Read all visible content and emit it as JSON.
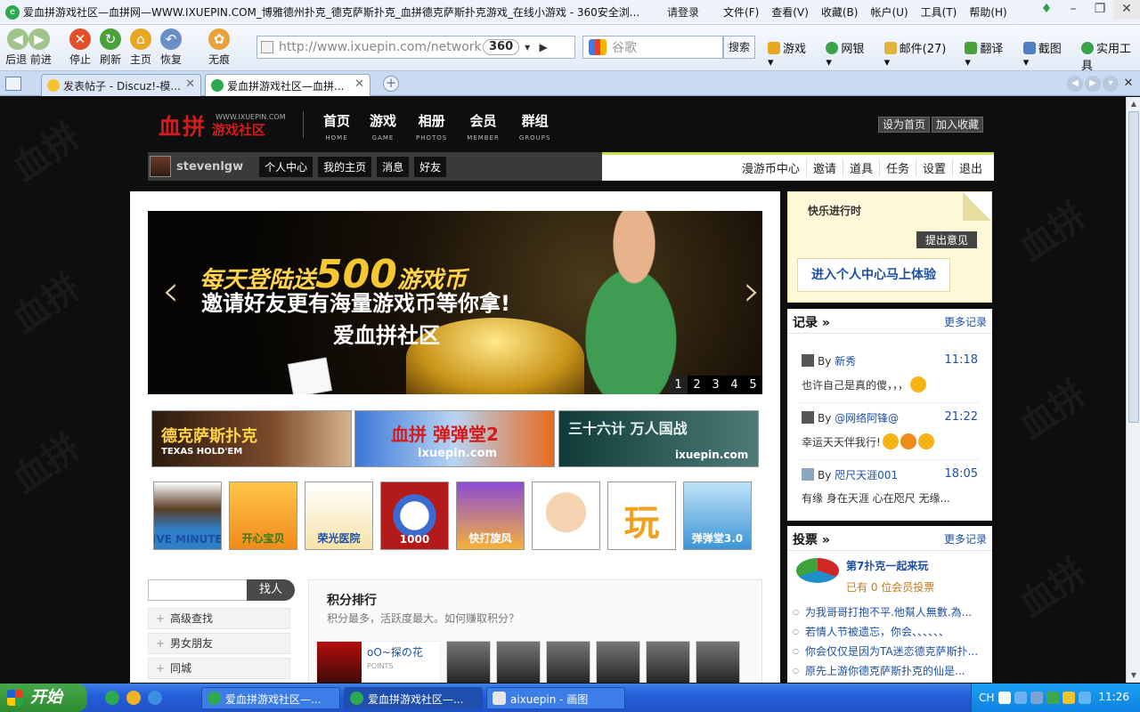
{
  "window": {
    "title": "爱血拼游戏社区—血拼网—WWW.IXUEPIN.COM_博雅德州扑克_德克萨斯扑克_血拼德克萨斯扑克游戏_在线小游戏 - 360安全浏...",
    "login": "请登录",
    "menus": [
      "文件(F)",
      "查看(V)",
      "收藏(B)",
      "帐户(U)",
      "工具(T)",
      "帮助(H)"
    ]
  },
  "toolbar": {
    "back_fwd": "后退 前进",
    "stop": "停止",
    "refresh": "刷新",
    "home": "主页",
    "restore": "恢复",
    "incognito": "无痕",
    "url": "http://www.ixuepin.com/network.ph",
    "badge": "360",
    "search_placeholder": "谷歌",
    "search_button": "搜索",
    "tools": [
      "游戏",
      "网银",
      "邮件(27)",
      "翻译",
      "截图",
      "实用工具"
    ]
  },
  "tabs": [
    {
      "label": "发表帖子 - Discuz!-模..."
    },
    {
      "label": "爱血拼游戏社区—血拼..."
    }
  ],
  "site": {
    "logo_main": "血拼",
    "logo_sub": "游戏社区",
    "logo_url": "WWW.IXUEPIN.COM",
    "nav": [
      {
        "cn": "首页",
        "en": "HOME"
      },
      {
        "cn": "游戏",
        "en": "GAME"
      },
      {
        "cn": "相册",
        "en": "PHOTOS"
      },
      {
        "cn": "会员",
        "en": "MEMBER"
      },
      {
        "cn": "群组",
        "en": "GROUPS"
      }
    ],
    "set_home": "设为首页",
    "add_fav": "加入收藏",
    "username": "stevenlgw",
    "user_links": [
      "个人中心",
      "我的主页",
      "消息",
      "好友"
    ],
    "right_links": [
      "漫游币中心",
      "邀请",
      "道具",
      "任务",
      "设置",
      "退出"
    ]
  },
  "banner": {
    "line1_a": "每天登陆送",
    "line1_b": "500",
    "line1_c": "游戏币",
    "line2": "邀请好友更有海量游戏币等你拿!",
    "line3": "爱血拼社区",
    "pages": [
      "1",
      "2",
      "3",
      "4",
      "5"
    ],
    "active_page": 1
  },
  "ads": [
    {
      "title": "德克萨斯扑克",
      "sub": "TEXAS HOLD'EM"
    },
    {
      "title": "血拼 弹弹堂2",
      "sub": "ixuepin.com"
    },
    {
      "title": "三十六计 万人国战",
      "sub": "ixuepin.com"
    }
  ],
  "games": [
    "FIVE MINUTES",
    "开心宝贝",
    "荣光医院",
    "1000",
    "快打旋风",
    "",
    "玩",
    "弹弹堂3.0"
  ],
  "find": {
    "button": "找人"
  },
  "side_links": [
    "高级查找",
    "男女朋友",
    "同城"
  ],
  "ranking": {
    "title": "积分排行",
    "desc": "积分最多，活跃度最大。如何赚取积分？",
    "first_name": "oO~探の花",
    "points_label": "POINTS"
  },
  "happy": {
    "title": "快乐进行时",
    "suggest": "提出意见",
    "cta": "进入个人中心马上体验"
  },
  "records": {
    "title": "记录 »",
    "more": "更多记录",
    "items": [
      {
        "by": "By",
        "who": "新秀",
        "time": "11:18",
        "msg": "也许自己是真的傻，，，"
      },
      {
        "by": "By",
        "who": "@网络阿锋@",
        "time": "21:22",
        "msg": "幸运天天伴我行!"
      },
      {
        "by": "By",
        "who": "咫尺天涯001",
        "time": "18:05",
        "msg": "有缘 身在天涯 心在咫尺 无缘..."
      }
    ]
  },
  "votes": {
    "title": "投票 »",
    "more": "更多记录",
    "featured_title": "第7扑克一起来玩",
    "featured_count": "已有 0 位会员投票",
    "items": [
      "为我哥哥打抱不平.他幫人無數.為...",
      "若情人节被遗忘，你会、、、、、、",
      "你会仅仅是因为TA迷恋德克萨斯扑...",
      "原先上游你德克萨斯扑克的仙是..."
    ]
  },
  "taskbar": {
    "start": "开始",
    "tasks": [
      "爱血拼游戏社区—...",
      "爱血拼游戏社区—...",
      "aixuepin - 画图"
    ],
    "lang": "CH",
    "clock": "11:26"
  },
  "colors": {
    "brand_red": "#d31c1c",
    "link_blue": "#1c4fa3",
    "accent_green": "#c8e04a"
  }
}
